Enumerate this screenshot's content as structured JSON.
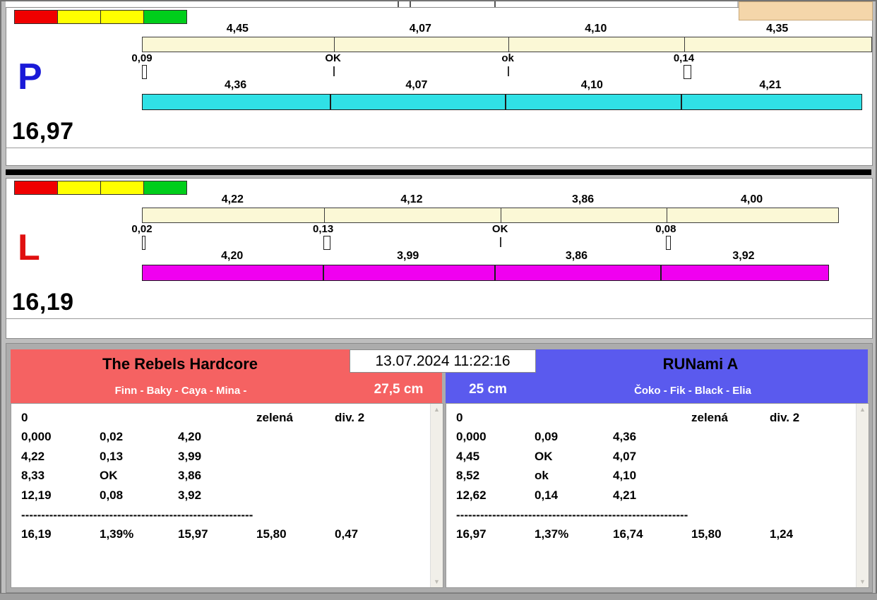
{
  "window": {
    "timestamp": "13.07.2024 11:22:16",
    "background_fragment_color": "#F4D6AA"
  },
  "icons": {
    "scroll_up": "▲",
    "scroll_down": "▼"
  },
  "lanes": [
    {
      "letter": "P",
      "letter_color": "#1A1AD8",
      "total": "16,97",
      "bar_color": "#30E1E6",
      "lights": [
        "#F00000",
        "#FFFF00",
        "#FFFF00",
        "#00CE1B"
      ],
      "upper_splits": [
        "4,45",
        "4,07",
        "4,10",
        "4,35"
      ],
      "cross_marks": [
        "0,09",
        "OK",
        "ok",
        "0,14"
      ],
      "lower_splits": [
        "4,36",
        "4,07",
        "4,10",
        "4,21"
      ]
    },
    {
      "letter": "L",
      "letter_color": "#E01010",
      "total": "16,19",
      "bar_color": "#F000F0",
      "lights": [
        "#F00000",
        "#FFFF00",
        "#FFFF00",
        "#00CE1B"
      ],
      "upper_splits": [
        "4,22",
        "4,12",
        "3,86",
        "4,00"
      ],
      "cross_marks": [
        "0,02",
        "0,13",
        "OK",
        "0,08"
      ],
      "lower_splits": [
        "4,20",
        "3,99",
        "3,86",
        "3,92"
      ]
    }
  ],
  "teams": [
    {
      "name": "The Rebels Hardcore",
      "dogs": "Finn - Baky - Caya - Mina -",
      "jump_height": "27,5 cm",
      "header_color": "#F56262",
      "rows": [
        [
          "0",
          "",
          "",
          "zelená",
          "div. 2"
        ],
        [
          "0,000",
          "0,02",
          "4,20"
        ],
        [
          "4,22",
          "0,13",
          "3,99"
        ],
        [
          "8,33",
          "OK",
          "3,86"
        ],
        [
          "12,19",
          "0,08",
          "3,92"
        ]
      ],
      "divider": "----------------------------------------------------------",
      "totals": [
        "16,19",
        "1,39%",
        "15,97",
        "15,80",
        "0,47"
      ]
    },
    {
      "name": "RUNami A",
      "dogs": "Čoko - Fik - Black - Elia",
      "jump_height": "25 cm",
      "header_color": "#5A5AEE",
      "rows": [
        [
          "0",
          "",
          "",
          "zelená",
          "div. 2"
        ],
        [
          "0,000",
          "0,09",
          "4,36"
        ],
        [
          "4,45",
          "OK",
          "4,07"
        ],
        [
          "8,52",
          "ok",
          "4,10"
        ],
        [
          "12,62",
          "0,14",
          "4,21"
        ]
      ],
      "divider": "----------------------------------------------------------",
      "totals": [
        "16,97",
        "1,37%",
        "16,74",
        "15,80",
        "1,24"
      ]
    }
  ]
}
